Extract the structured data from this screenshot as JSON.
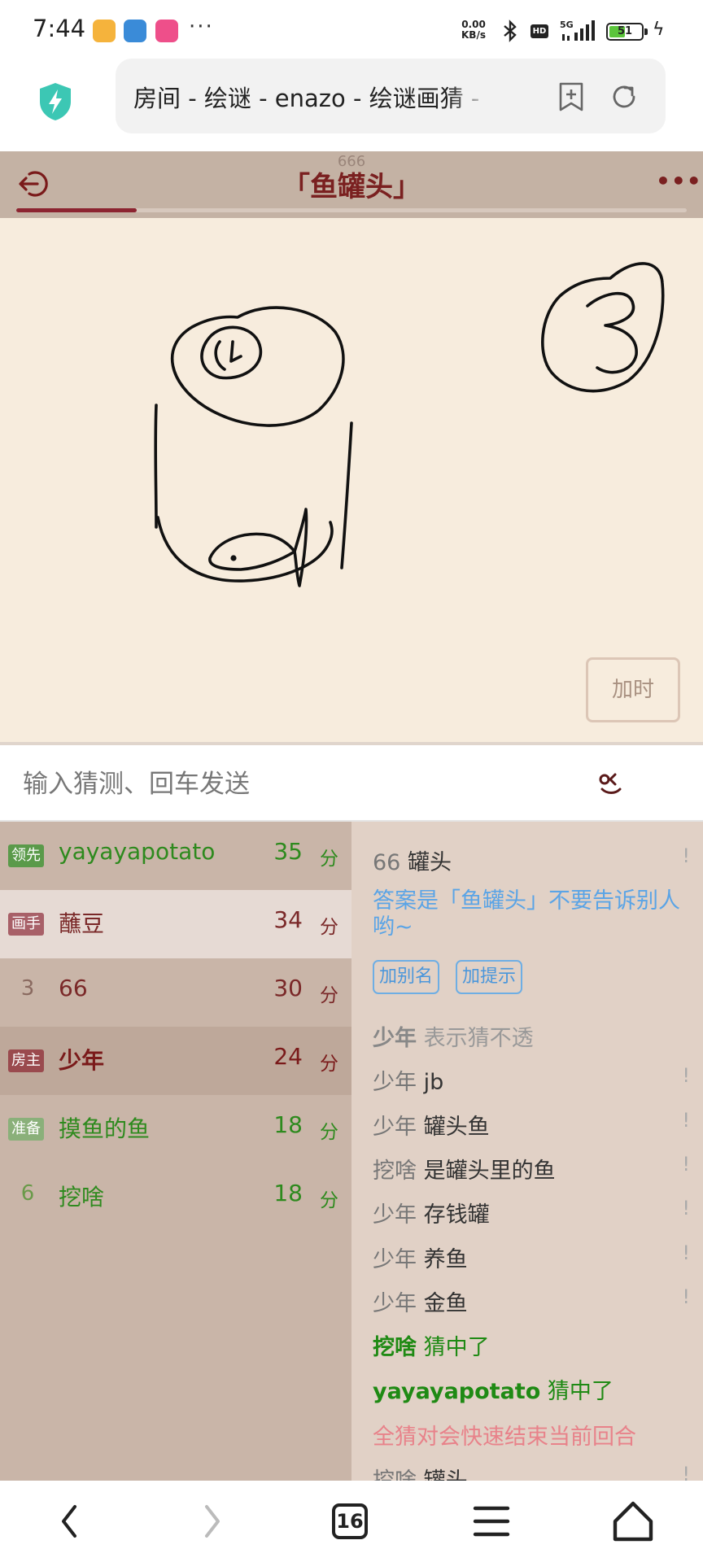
{
  "status_bar": {
    "time": "7:44",
    "app_icons": [
      {
        "name": "notes-app-icon",
        "color": "#f5b33c"
      },
      {
        "name": "avatar-app-icon",
        "color": "#3a8bd8"
      },
      {
        "name": "video-app-icon",
        "color": "#ee4f8a"
      }
    ],
    "more": "···",
    "net_speed_value": "0.00",
    "net_speed_unit": "KB/s",
    "hd": "HD",
    "network": "5G",
    "battery": "51",
    "battery_level": 0.51
  },
  "browser": {
    "url_title": "房间 - 绘谜 - enazo - 绘谜画猜 -"
  },
  "game": {
    "room_number": "666",
    "word_title": "「鱼罐头」",
    "round_progress": 0.18,
    "add_time_label": "加时",
    "guess_placeholder": "输入猜测、回车发送"
  },
  "players": [
    {
      "badge": "领先",
      "badge_color": "#5a9a4a",
      "rank": "",
      "name": "yayayapotato",
      "score": "35",
      "unit": "分",
      "color": "#2e8a1e",
      "bg": "#c9b5a8",
      "bold": false
    },
    {
      "badge": "画手",
      "badge_color": "#a86068",
      "rank": "",
      "name": "蘸豆",
      "score": "34",
      "unit": "分",
      "color": "#7a2828",
      "bg": "#e6dad4",
      "bold": false
    },
    {
      "badge": "",
      "badge_color": "",
      "rank": "3",
      "name": "66",
      "score": "30",
      "unit": "分",
      "color": "#7a2828",
      "bg": "#c9b5a8",
      "bold": false
    },
    {
      "badge": "房主",
      "badge_color": "#9a4a4e",
      "rank": "",
      "name": "少年",
      "score": "24",
      "unit": "分",
      "color": "#7a1a1a",
      "bg": "#bea89a",
      "bold": true
    },
    {
      "badge": "准备",
      "badge_color": "#8ab07a",
      "rank": "",
      "name": "摸鱼的鱼",
      "score": "18",
      "unit": "分",
      "color": "#2e8a1e",
      "bg": "#c9b5a8",
      "bold": false
    },
    {
      "badge": "",
      "badge_color": "",
      "rank": "6",
      "name": "挖啥",
      "score": "18",
      "unit": "分",
      "color": "#2e8a1e",
      "bg": "#c9b5a8",
      "bold": false
    }
  ],
  "chat": {
    "first": {
      "user": "66",
      "msg": "罐头",
      "flag": "!"
    },
    "answer_notice": "答案是「鱼罐头」不要告诉别人哟~",
    "add_alias": "加别名",
    "add_hint": "加提示",
    "messages": [
      {
        "user": "少年",
        "msg": "表示猜不透",
        "flag": "",
        "style": "system"
      },
      {
        "user": "少年",
        "msg": "jb",
        "flag": "!",
        "style": "normal"
      },
      {
        "user": "少年",
        "msg": "罐头鱼",
        "flag": "!",
        "style": "normal"
      },
      {
        "user": "挖啥",
        "msg": "是罐头里的鱼",
        "flag": "!",
        "style": "normal"
      },
      {
        "user": "少年",
        "msg": "存钱罐",
        "flag": "!",
        "style": "normal"
      },
      {
        "user": "少年",
        "msg": "养鱼",
        "flag": "!",
        "style": "normal"
      },
      {
        "user": "少年",
        "msg": "金鱼",
        "flag": "!",
        "style": "normal"
      },
      {
        "user": "挖啥",
        "msg": "猜中了",
        "flag": "",
        "style": "correct"
      },
      {
        "user": "yayayapotato",
        "msg": "猜中了",
        "flag": "",
        "style": "correct"
      }
    ],
    "warning": "全猜对会快速结束当前回合",
    "last": {
      "user": "挖啥",
      "msg": "罐头。",
      "flag": "!"
    }
  },
  "bottom_nav": {
    "tab_count": "16"
  }
}
